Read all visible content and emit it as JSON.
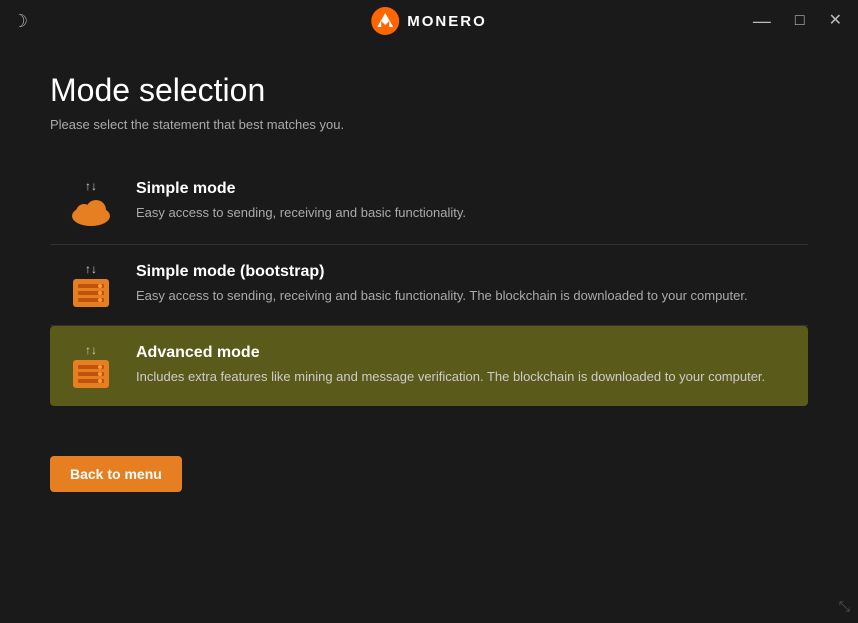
{
  "titlebar": {
    "app_name": "MONERO",
    "min_label": "—",
    "max_label": "□",
    "close_label": "✕"
  },
  "page": {
    "title": "Mode selection",
    "subtitle": "Please select the statement that best matches you."
  },
  "modes": [
    {
      "id": "simple",
      "name": "Simple mode",
      "description": "Easy access to sending, receiving and basic functionality.",
      "active": false,
      "icon_type": "cloud"
    },
    {
      "id": "simple-bootstrap",
      "name": "Simple mode (bootstrap)",
      "description": "Easy access to sending, receiving and basic functionality. The blockchain is downloaded to your computer.",
      "active": false,
      "icon_type": "server"
    },
    {
      "id": "advanced",
      "name": "Advanced mode",
      "description": "Includes extra features like mining and message verification. The blockchain is downloaded to your computer.",
      "active": true,
      "icon_type": "server"
    }
  ],
  "buttons": {
    "back_label": "Back to menu"
  }
}
